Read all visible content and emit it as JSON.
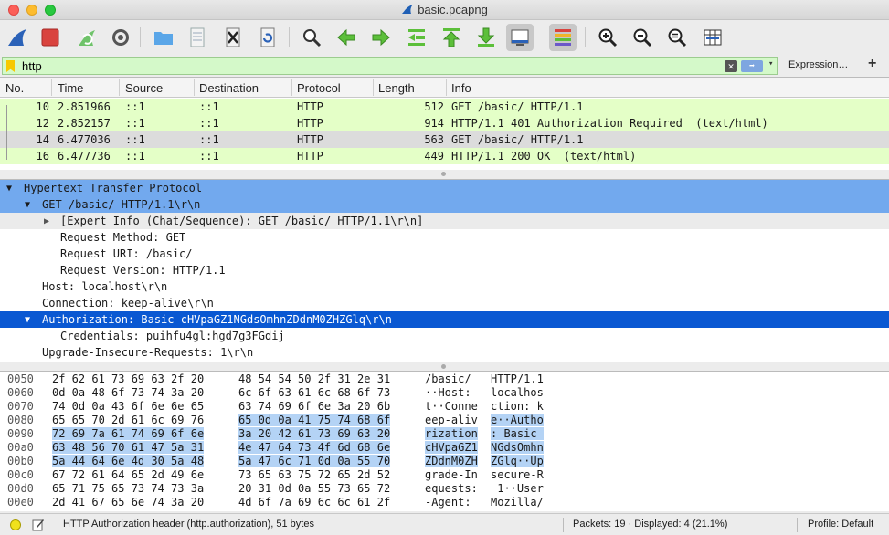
{
  "window": {
    "title": "basic.pcapng"
  },
  "colors": {
    "filter_bg": "#d4f9c9",
    "row_http": "#e4ffc7",
    "row_selected": "#dcdcdc",
    "detail_highlight": "#72a9ee",
    "detail_selected": "#0a58d2",
    "hex_highlight": "#b4d3f5"
  },
  "toolbar": {
    "icons": [
      "shark-fin-start-icon",
      "stop-square-icon",
      "restart-capture-icon",
      "gear-options-icon",
      "folder-open-icon",
      "file-icon",
      "close-file-icon",
      "reload-icon",
      "search-icon",
      "go-back-icon",
      "go-forward-icon",
      "go-to-packet-icon",
      "first-packet-icon",
      "last-packet-icon",
      "autoscroll-icon",
      "colorize-icon",
      "zoom-in-icon",
      "zoom-out-icon",
      "zoom-normal-icon",
      "resize-columns-icon"
    ]
  },
  "filter": {
    "value": "http",
    "expression_label": "Expression…",
    "add_label": "+",
    "clear_label": "✕",
    "apply_label": "➡",
    "dropdown_label": "▾"
  },
  "packet_list": {
    "columns": [
      "No.",
      "Time",
      "Source",
      "Destination",
      "Protocol",
      "Length",
      "Info"
    ],
    "rows": [
      {
        "no": "10",
        "time": "2.851966",
        "source": "::1",
        "destination": "::1",
        "protocol": "HTTP",
        "length": "512",
        "info": "GET /basic/ HTTP/1.1"
      },
      {
        "no": "12",
        "time": "2.852157",
        "source": "::1",
        "destination": "::1",
        "protocol": "HTTP",
        "length": "914",
        "info": "HTTP/1.1 401 Authorization Required  (text/html)"
      },
      {
        "no": "14",
        "time": "6.477036",
        "source": "::1",
        "destination": "::1",
        "protocol": "HTTP",
        "length": "563",
        "info": "GET /basic/ HTTP/1.1"
      },
      {
        "no": "16",
        "time": "6.477736",
        "source": "::1",
        "destination": "::1",
        "protocol": "HTTP",
        "length": "449",
        "info": "HTTP/1.1 200 OK  (text/html)"
      }
    ]
  },
  "details": {
    "rows": [
      {
        "text": "Hypertext Transfer Protocol",
        "arrow": "▼"
      },
      {
        "text": "GET /basic/ HTTP/1.1\\r\\n",
        "arrow": "▼"
      },
      {
        "text": "[Expert Info (Chat/Sequence): GET /basic/ HTTP/1.1\\r\\n]",
        "arrow": "▶"
      },
      {
        "text": "Request Method: GET",
        "arrow": ""
      },
      {
        "text": "Request URI: /basic/",
        "arrow": ""
      },
      {
        "text": "Request Version: HTTP/1.1",
        "arrow": ""
      },
      {
        "text": "Host: localhost\\r\\n",
        "arrow": ""
      },
      {
        "text": "Connection: keep-alive\\r\\n",
        "arrow": ""
      },
      {
        "text": "Authorization: Basic cHVpaGZ1NGdsOmhnZDdnM0ZHZGlq\\r\\n",
        "arrow": "▼"
      },
      {
        "text": "Credentials: puihfu4gl:hgd7g3FGdij",
        "arrow": ""
      },
      {
        "text": "Upgrade-Insecure-Requests: 1\\r\\n",
        "arrow": ""
      }
    ]
  },
  "hex": {
    "rows": [
      {
        "offset": "0050",
        "b1": "2f 62 61 73 69 63 2f 20",
        "b2": "48 54 54 50 2f 31 2e 31",
        "a1": "/basic/ ",
        "a2": "HTTP/1.1"
      },
      {
        "offset": "0060",
        "b1": "0d 0a 48 6f 73 74 3a 20",
        "b2": "6c 6f 63 61 6c 68 6f 73",
        "a1": "··Host: ",
        "a2": "localhos"
      },
      {
        "offset": "0070",
        "b1": "74 0d 0a 43 6f 6e 6e 65",
        "b2": "63 74 69 6f 6e 3a 20 6b",
        "a1": "t··Conne",
        "a2": "ction: k"
      },
      {
        "offset": "0080",
        "b1": "65 65 70 2d 61 6c 69 76",
        "b2": "65 0d 0a 41 75 74 68 6f",
        "a1": "eep-aliv",
        "a2": "e··Autho"
      },
      {
        "offset": "0090",
        "b1": "72 69 7a 61 74 69 6f 6e",
        "b2": "3a 20 42 61 73 69 63 20",
        "a1": "rization",
        "a2": ": Basic "
      },
      {
        "offset": "00a0",
        "b1": "63 48 56 70 61 47 5a 31",
        "b2": "4e 47 64 73 4f 6d 68 6e",
        "a1": "cHVpaGZ1",
        "a2": "NGdsOmhn"
      },
      {
        "offset": "00b0",
        "b1": "5a 44 64 6e 4d 30 5a 48",
        "b2": "5a 47 6c 71 0d 0a 55 70",
        "a1": "ZDdnM0ZH",
        "a2": "ZGlq··Up"
      },
      {
        "offset": "00c0",
        "b1": "67 72 61 64 65 2d 49 6e",
        "b2": "73 65 63 75 72 65 2d 52",
        "a1": "grade-In",
        "a2": "secure-R"
      },
      {
        "offset": "00d0",
        "b1": "65 71 75 65 73 74 73 3a",
        "b2": "20 31 0d 0a 55 73 65 72",
        "a1": "equests:",
        "a2": " 1··User"
      },
      {
        "offset": "00e0",
        "b1": "2d 41 67 65 6e 74 3a 20",
        "b2": "4d 6f 7a 69 6c 6c 61 2f",
        "a1": "-Agent: ",
        "a2": "Mozilla/"
      }
    ]
  },
  "status": {
    "field_info": "HTTP Authorization header (http.authorization), 51 bytes",
    "packets": "Packets: 19 · Displayed: 4 (21.1%)",
    "profile": "Profile: Default"
  }
}
